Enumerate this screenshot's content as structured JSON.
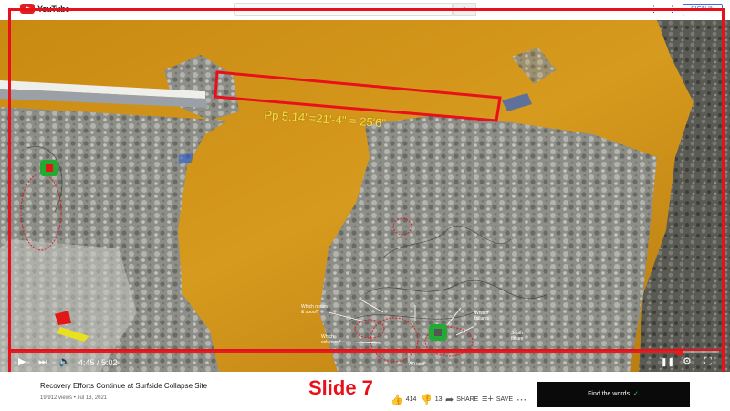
{
  "header": {
    "logo_text": "YouTube",
    "search_icon": "search-icon",
    "icons": [
      "apps-icon",
      "more-vertical-icon"
    ],
    "apps_glyph": "⋮⋮",
    "more_glyph": "⋮",
    "signin_label": "SIGN IN"
  },
  "video": {
    "measurement_label": "Pp 5.14\"=21'-4\" = 25'6\"",
    "annotations": {
      "note_a": "Which nodes\n& spool?",
      "note_b": "Which\ncolumns?",
      "note_c": "Whitch\nfailures",
      "note_d": "South\nfailure"
    },
    "watermark": "AR kiss",
    "player": {
      "current_time": "4:45",
      "duration": "5:02",
      "progress_fraction": 0.944,
      "time_display": "4:45 / 5:02"
    },
    "colors": {
      "frame": "#e8101a",
      "measurement_text": "#f4e14a",
      "marker_green": "#22aa33"
    }
  },
  "below": {
    "title": "Recovery Efforts Continue at Surfside Collapse Site",
    "meta": "19,912 views • Jul 13, 2021",
    "slide_label": "Slide 7",
    "actions": {
      "like_count": "414",
      "dislike_count": "13",
      "share_label": "SHARE",
      "save_label": "SAVE",
      "more_glyph": "⋯"
    },
    "ad": {
      "text": "Find the words.",
      "check": "✓"
    }
  }
}
